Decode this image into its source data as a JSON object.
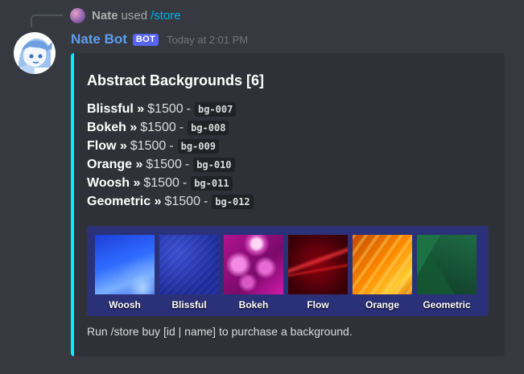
{
  "reply": {
    "name": "Nate",
    "used": "used",
    "command": "/store"
  },
  "message": {
    "author": "Nate Bot",
    "badge": "BOT",
    "timestamp": "Today at 2:01 PM"
  },
  "embed": {
    "accent_color": "#00f0ff",
    "title": "Abstract Backgrounds [6]",
    "items": [
      {
        "name": "Blissful »",
        "price": "$1500",
        "sep": "-",
        "id": "bg-007"
      },
      {
        "name": "Bokeh »",
        "price": "$1500",
        "sep": "-",
        "id": "bg-008"
      },
      {
        "name": "Flow »",
        "price": "$1500",
        "sep": "-",
        "id": "bg-009"
      },
      {
        "name": "Orange »",
        "price": "$1500",
        "sep": "-",
        "id": "bg-010"
      },
      {
        "name": "Woosh »",
        "price": "$1500",
        "sep": "-",
        "id": "bg-011"
      },
      {
        "name": "Geometric »",
        "price": "$1500",
        "sep": "-",
        "id": "bg-012"
      }
    ],
    "gallery": [
      {
        "label": "Woosh"
      },
      {
        "label": "Blissful"
      },
      {
        "label": "Bokeh"
      },
      {
        "label": "Flow"
      },
      {
        "label": "Orange"
      },
      {
        "label": "Geometric"
      }
    ],
    "footer": "Run /store buy [id | name] to purchase a background."
  }
}
